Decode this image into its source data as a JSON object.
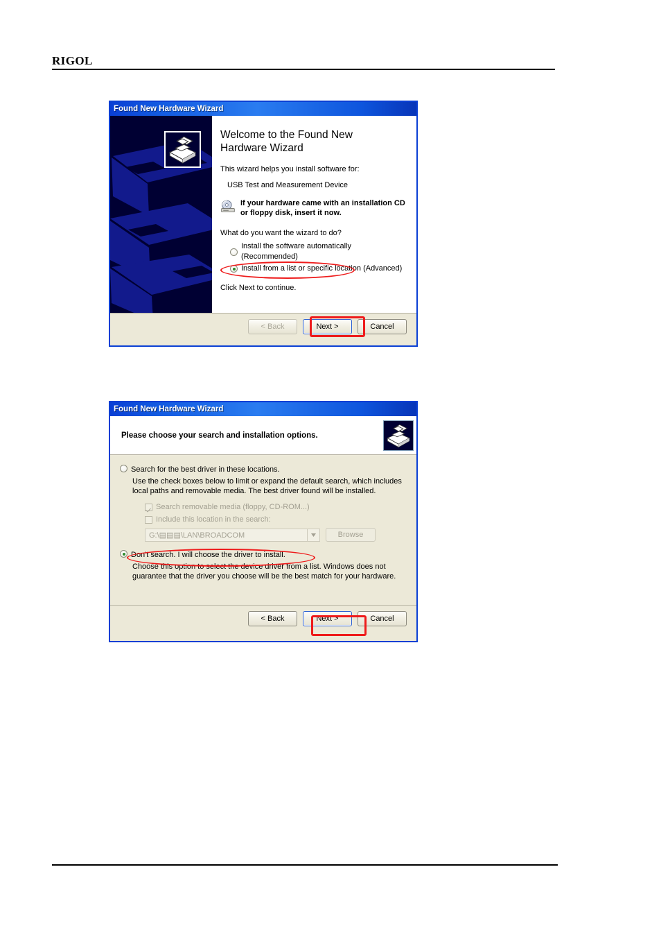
{
  "page": {
    "brand": "RIGOL"
  },
  "dialog1": {
    "title": "Found New Hardware Wizard",
    "heading": "Welcome to the Found New\nHardware Wizard",
    "intro": "This wizard helps you install software for:",
    "device": "USB Test and Measurement Device",
    "cd_note": "If your hardware came with an installation CD or floppy disk, insert it now.",
    "question": "What do you want the wizard to do?",
    "options": [
      {
        "label": "Install the software automatically (Recommended)",
        "checked": false
      },
      {
        "label": "Install from a list or specific location (Advanced)",
        "checked": true
      }
    ],
    "continue_note": "Click Next to continue.",
    "buttons": {
      "back": "< Back",
      "next": "Next >",
      "cancel": "Cancel"
    },
    "icons": {
      "banner": "hardware-wizard-icon",
      "cd": "cd-drive-icon"
    }
  },
  "dialog2": {
    "title": "Found New Hardware Wizard",
    "heading": "Please choose your search and installation options.",
    "option_search": {
      "label": "Search for the best driver in these locations.",
      "checked": false,
      "description": "Use the check boxes below to limit or expand the default search, which includes local paths and removable media. The best driver found will be installed."
    },
    "checkboxes": [
      {
        "label": "Search removable media (floppy, CD-ROM...)",
        "checked": true
      },
      {
        "label": "Include this location in the search:",
        "checked": false
      }
    ],
    "path_value": "G:\\▤▤▤\\LAN\\BROADCOM",
    "browse_label": "Browse",
    "option_nosearch": {
      "label": "Don't search. I will choose the driver to install.",
      "checked": true,
      "description": "Choose this option to select the device driver from a list. Windows does not guarantee that the driver you choose will be the best match for your hardware."
    },
    "buttons": {
      "back": "< Back",
      "next": "Next >",
      "cancel": "Cancel"
    },
    "icons": {
      "header": "hardware-wizard-icon"
    }
  },
  "annotations": {
    "accent_color": "#ee1b1b"
  }
}
